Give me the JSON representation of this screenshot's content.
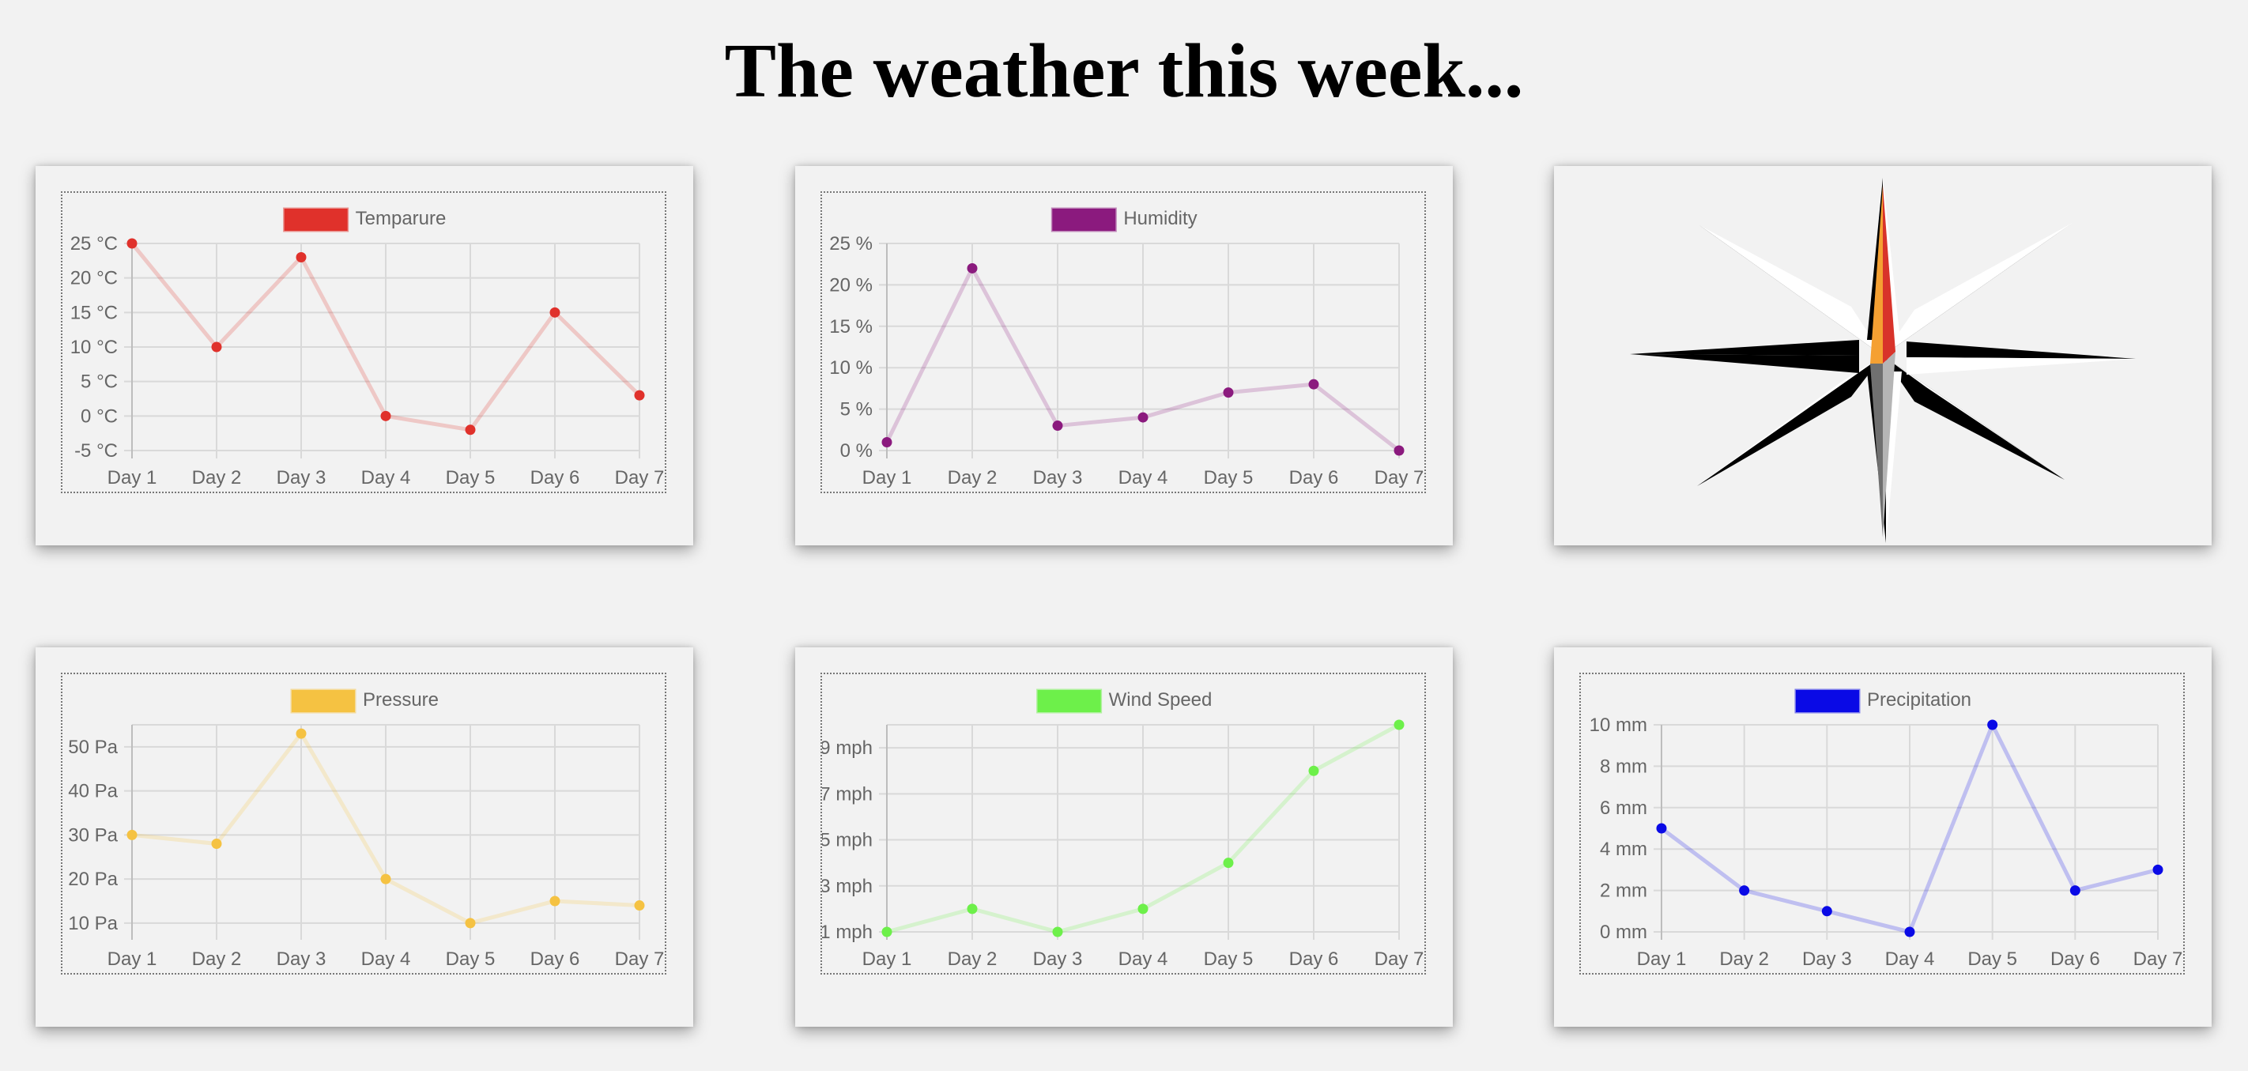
{
  "page": {
    "title": "The weather this week..."
  },
  "chart_data": [
    {
      "id": "temperature",
      "type": "line",
      "title": "",
      "categories": [
        "Day 1",
        "Day 2",
        "Day 3",
        "Day 4",
        "Day 5",
        "Day 6",
        "Day 7"
      ],
      "series": [
        {
          "name": "Temparure",
          "values": [
            25,
            10,
            23,
            0,
            -2,
            15,
            3
          ],
          "color": "#e0312b"
        }
      ],
      "yticks": [
        25,
        20,
        15,
        10,
        5,
        0,
        -5
      ],
      "unit": "°C",
      "ylim": [
        -5,
        25
      ],
      "legend_position": "top",
      "grid": true
    },
    {
      "id": "humidity",
      "type": "line",
      "title": "",
      "categories": [
        "Day 1",
        "Day 2",
        "Day 3",
        "Day 4",
        "Day 5",
        "Day 6",
        "Day 7"
      ],
      "series": [
        {
          "name": "Humidity",
          "values": [
            1,
            22,
            3,
            4,
            7,
            8,
            0
          ],
          "color": "#8b1a7e"
        }
      ],
      "yticks": [
        25,
        20,
        15,
        10,
        5,
        0
      ],
      "unit": "%",
      "ylim": [
        0,
        25
      ],
      "legend_position": "top",
      "grid": true
    },
    {
      "id": "pressure",
      "type": "line",
      "title": "",
      "categories": [
        "Day 1",
        "Day 2",
        "Day 3",
        "Day 4",
        "Day 5",
        "Day 6",
        "Day 7"
      ],
      "series": [
        {
          "name": "Pressure",
          "values": [
            30,
            28,
            53,
            20,
            10,
            15,
            14
          ],
          "color": "#f5c242"
        }
      ],
      "yticks": [
        50,
        40,
        30,
        20,
        10
      ],
      "unit": "Pa",
      "ylim": [
        8,
        55
      ],
      "legend_position": "top",
      "grid": true
    },
    {
      "id": "wind",
      "type": "line",
      "title": "",
      "categories": [
        "Day 1",
        "Day 2",
        "Day 3",
        "Day 4",
        "Day 5",
        "Day 6",
        "Day 7"
      ],
      "series": [
        {
          "name": "Wind Speed",
          "values": [
            1,
            2,
            1,
            2,
            4,
            8,
            10
          ],
          "color": "#6df04a"
        }
      ],
      "yticks": [
        9,
        7,
        5,
        3,
        1
      ],
      "unit": "mph",
      "ylim": [
        1,
        10
      ],
      "legend_position": "top",
      "grid": true
    },
    {
      "id": "precip",
      "type": "line",
      "title": "",
      "categories": [
        "Day 1",
        "Day 2",
        "Day 3",
        "Day 4",
        "Day 5",
        "Day 6",
        "Day 7"
      ],
      "series": [
        {
          "name": "Precipitation",
          "values": [
            5,
            2,
            1,
            0,
            10,
            2,
            3
          ],
          "color": "#0a0ae6"
        }
      ],
      "yticks": [
        10,
        8,
        6,
        4,
        2,
        0
      ],
      "unit": "mm",
      "ylim": [
        0,
        10
      ],
      "legend_position": "top",
      "grid": true
    }
  ],
  "compass": {
    "icon": "compass-rose-icon",
    "north_colors": [
      "#f5a032",
      "#d8332a"
    ]
  }
}
